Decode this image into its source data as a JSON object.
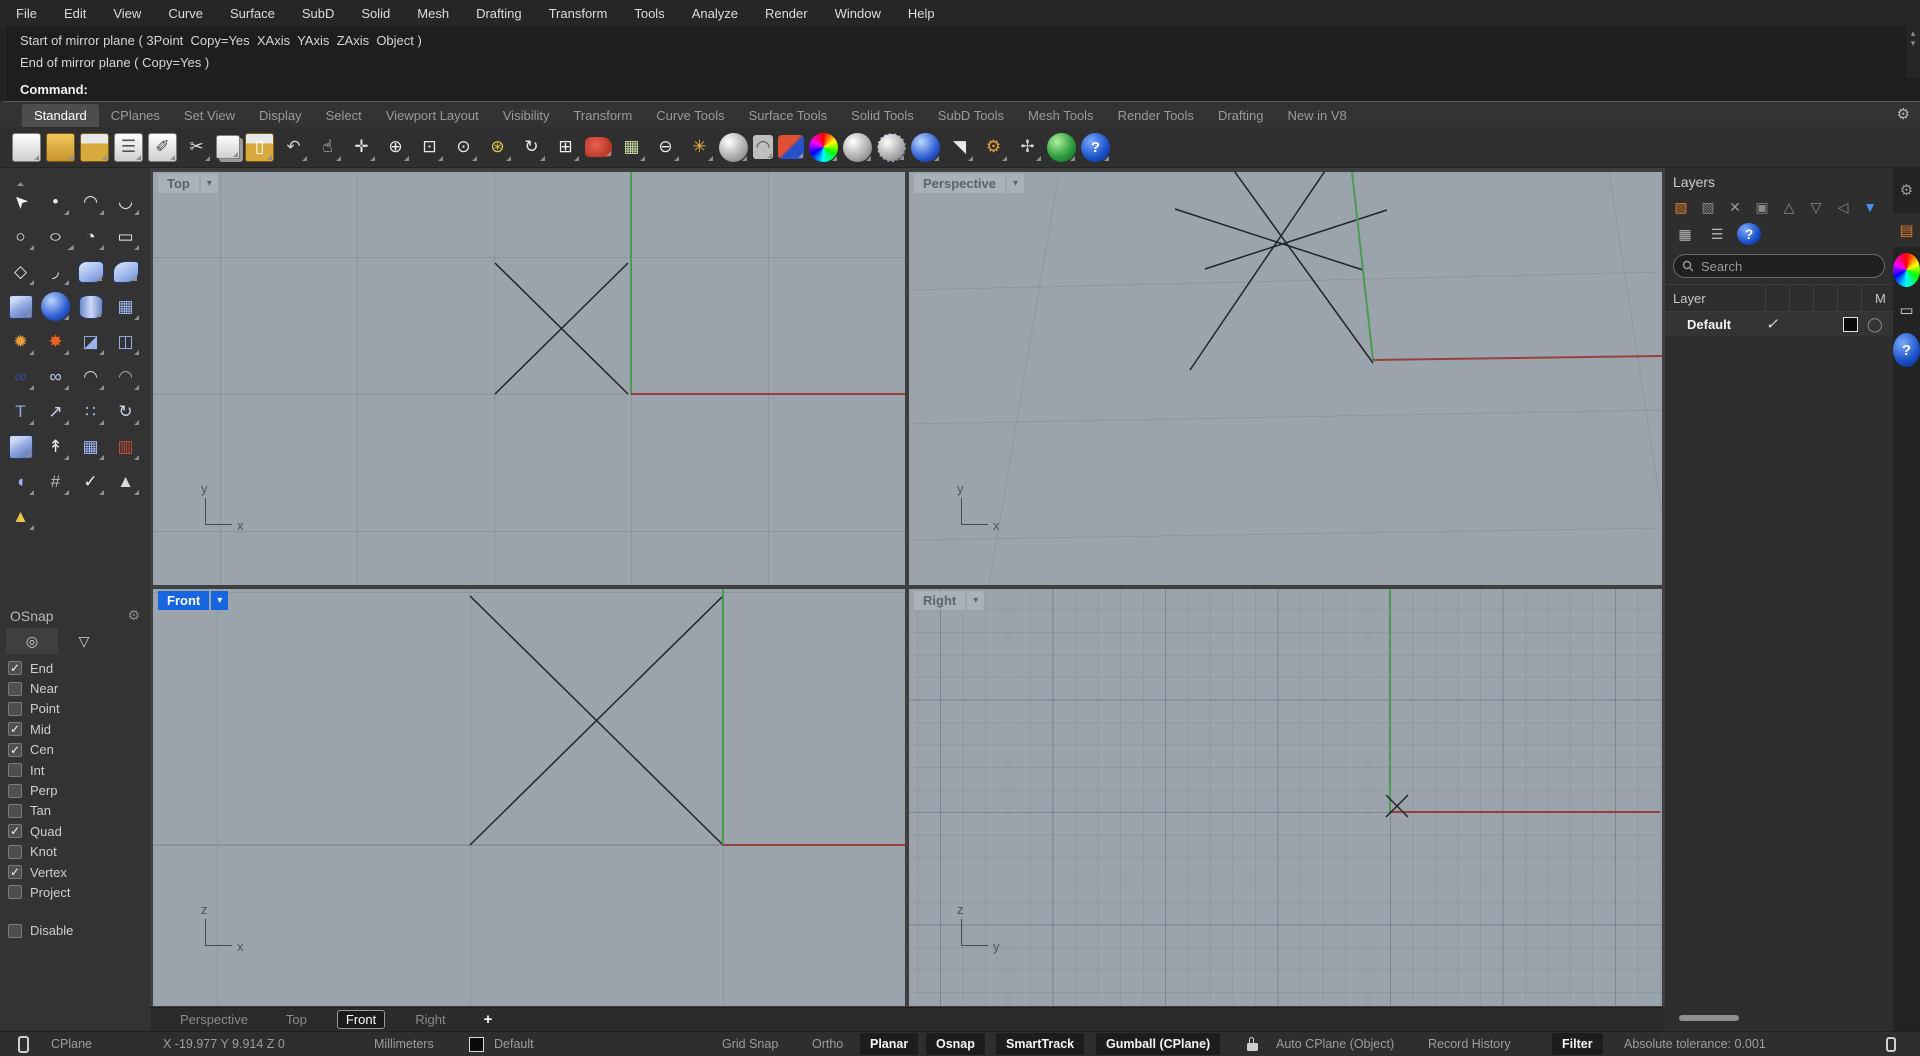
{
  "icons": {
    "gear": "⚙",
    "chevron_down": "▾",
    "scroll_up": "▴",
    "scroll_down": "▾",
    "plus": "+",
    "layer_check": "✓",
    "material_circle": "◯"
  },
  "menu": {
    "items": [
      "File",
      "Edit",
      "View",
      "Curve",
      "Surface",
      "SubD",
      "Solid",
      "Mesh",
      "Drafting",
      "Transform",
      "Tools",
      "Analyze",
      "Render",
      "Window",
      "Help"
    ]
  },
  "command": {
    "history": [
      "Start of mirror plane ( 3Point  Copy=Yes  XAxis  YAxis  ZAxis  Object )",
      "End of mirror plane ( Copy=Yes )"
    ],
    "prompt": "Command:"
  },
  "ribbon": {
    "tabs": [
      {
        "label": "Standard",
        "state": "active"
      },
      {
        "label": "CPlanes"
      },
      {
        "label": "Set View"
      },
      {
        "label": "Display"
      },
      {
        "label": "Select"
      },
      {
        "label": "Viewport Layout"
      },
      {
        "label": "Visibility"
      },
      {
        "label": "Transform"
      },
      {
        "label": "Curve Tools"
      },
      {
        "label": "Surface Tools"
      },
      {
        "label": "Solid Tools"
      },
      {
        "label": "SubD Tools"
      },
      {
        "label": "Mesh Tools"
      },
      {
        "label": "Render Tools"
      },
      {
        "label": "Drafting"
      },
      {
        "label": "New in V8"
      }
    ]
  },
  "toolbar": {
    "icons": [
      {
        "name": "new-file-icon",
        "glyph": "",
        "cls": "ic-page"
      },
      {
        "name": "open-file-icon",
        "glyph": "",
        "cls": "ic-folder"
      },
      {
        "name": "save-icon",
        "glyph": "",
        "cls": "ic-floppy"
      },
      {
        "name": "print-icon",
        "glyph": "☰",
        "cls": "ic-page",
        "fg": "#555555"
      },
      {
        "name": "edit-properties-icon",
        "glyph": "✐",
        "cls": "ic-page",
        "fg": "#444444"
      },
      {
        "name": "cut-icon",
        "glyph": "✂",
        "fg": "#dfe4ea"
      },
      {
        "name": "copy-icon",
        "glyph": "",
        "cls": "ic-page ic-copy"
      },
      {
        "name": "paste-icon",
        "glyph": "▯",
        "cls": "ic-floppy",
        "fg": "#ffffff"
      },
      {
        "name": "undo-icon",
        "glyph": "↶",
        "fg": "#cfcfcf"
      },
      {
        "name": "pan-icon",
        "glyph": "☝",
        "fg": "#f0f0f0"
      },
      {
        "name": "rotate-view-icon",
        "glyph": "✛",
        "fg": "#e8e8e8"
      },
      {
        "name": "zoom-icon",
        "glyph": "⊕",
        "fg": "#e8e8e8"
      },
      {
        "name": "zoom-window-icon",
        "glyph": "⊡",
        "fg": "#e8e8e8"
      },
      {
        "name": "zoom-selected-icon",
        "glyph": "⊙",
        "fg": "#e8e8e8"
      },
      {
        "name": "zoom-extents-icon",
        "glyph": "⊛",
        "fg": "#e8c84a"
      },
      {
        "name": "zoom-back-icon",
        "glyph": "↻",
        "fg": "#e8e8e8"
      },
      {
        "name": "viewport-layout-icon",
        "glyph": "⊞",
        "fg": "#f0f0f0"
      },
      {
        "name": "named-views-icon",
        "glyph": "",
        "cls": "ic-car"
      },
      {
        "name": "display-options-icon",
        "glyph": "▦",
        "fg": "#c8d8a0"
      },
      {
        "name": "cplane-icon",
        "glyph": "⊖",
        "fg": "#e8e8e8"
      },
      {
        "name": "osnap-settings-icon",
        "glyph": "✳",
        "fg": "#e8b13a"
      },
      {
        "name": "lamp-icon",
        "glyph": "",
        "cls": "ic-sph-w"
      },
      {
        "name": "lock-icon",
        "glyph": "◠",
        "cls": "ic-lockbody",
        "fg": "#555555"
      },
      {
        "name": "render-icon",
        "glyph": "",
        "cls": "ic-render"
      },
      {
        "name": "color-wheel-icon",
        "glyph": "",
        "cls": "ic-wheel"
      },
      {
        "name": "shaded-sphere-icon",
        "glyph": "",
        "cls": "ic-sph-w"
      },
      {
        "name": "rendered-sphere-icon",
        "glyph": "",
        "cls": "ic-sph-w ic-dots"
      },
      {
        "name": "raytrace-sphere-icon",
        "glyph": "",
        "cls": "ic-sph-b"
      },
      {
        "name": "spotlight-icon",
        "glyph": "◥",
        "fg": "#e8e8e8"
      },
      {
        "name": "options-gear-icon",
        "glyph": "⚙",
        "fg": "#e8a13a"
      },
      {
        "name": "gumball-widget-icon",
        "glyph": "✢",
        "fg": "#d0d0d0"
      },
      {
        "name": "earth-icon",
        "glyph": "",
        "cls": "ic-globe"
      },
      {
        "name": "help-icon",
        "glyph": "?",
        "cls": "ic-help"
      }
    ]
  },
  "sidebar": {
    "icons": [
      {
        "name": "select-arrow-icon",
        "glyph": "➤",
        "cls": "rot-up-left",
        "fg": "#f2f2f2"
      },
      {
        "name": "point-icon",
        "glyph": "•",
        "fg": "#e8e8e8"
      },
      {
        "name": "control-point-curve-icon",
        "glyph": "◠",
        "fg": "#e8e8e8"
      },
      {
        "name": "interpolate-curve-icon",
        "glyph": "◡",
        "fg": "#e8e8e8"
      },
      {
        "name": "circle-icon",
        "glyph": "○",
        "fg": "#e8e8e8"
      },
      {
        "name": "ellipse-icon",
        "glyph": "○",
        "cls": "wide",
        "fg": "#e8e8e8"
      },
      {
        "name": "arc-icon",
        "glyph": "◔",
        "fg": "#e8e8e8"
      },
      {
        "name": "rectangle-icon",
        "glyph": "▭",
        "fg": "#e8e8e8"
      },
      {
        "name": "polygon-icon",
        "glyph": "◇",
        "fg": "#e8e8e8"
      },
      {
        "name": "fillet-corner-icon",
        "glyph": "◞",
        "fg": "#e8e8e8"
      },
      {
        "name": "surface-from-points-icon",
        "glyph": "",
        "cls": "ic-patch"
      },
      {
        "name": "curved-surface-icon",
        "glyph": "",
        "cls": "ic-patch curved"
      },
      {
        "name": "box-icon",
        "glyph": "",
        "cls": "ic-cube"
      },
      {
        "name": "sphere-icon",
        "glyph": "",
        "cls": "ic-sph-b"
      },
      {
        "name": "cylinder-icon",
        "glyph": "",
        "cls": "ic-cyl"
      },
      {
        "name": "patch-grid-icon",
        "glyph": "▦",
        "fg": "#9ab4ec"
      },
      {
        "name": "explode-icon",
        "glyph": "✹",
        "fg": "#e8a13a"
      },
      {
        "name": "blast-icon",
        "glyph": "✸",
        "fg": "#e8641e"
      },
      {
        "name": "trim-icon",
        "glyph": "◪",
        "fg": "#9ab4ec"
      },
      {
        "name": "split-icon",
        "glyph": "◫",
        "fg": "#9ab4ec"
      },
      {
        "name": "boolean-union-icon",
        "glyph": "∞",
        "fg": "#3a4a9a"
      },
      {
        "name": "boolean-difference-icon",
        "glyph": "∞",
        "fg": "#bcd0f8"
      },
      {
        "name": "blend-curve-icon",
        "glyph": "◠",
        "fg": "#d8d8d8"
      },
      {
        "name": "adjustable-blend-icon",
        "glyph": "◠",
        "fg": "#a8a8a8"
      },
      {
        "name": "text-icon",
        "glyph": "T",
        "fg": "#8fa8e0"
      },
      {
        "name": "move-icon",
        "glyph": "↗",
        "fg": "#c8d4ec"
      },
      {
        "name": "copy-objects-icon",
        "glyph": "∷",
        "fg": "#9ab4ec"
      },
      {
        "name": "rotate-icon",
        "glyph": "↻",
        "fg": "#c8d4ec"
      },
      {
        "name": "solid-cube-icon",
        "glyph": "",
        "cls": "ic-cube"
      },
      {
        "name": "extrude-icon",
        "glyph": "↟",
        "fg": "#e8e8e8"
      },
      {
        "name": "array-icon",
        "glyph": "▦",
        "fg": "#9ab4ec"
      },
      {
        "name": "block-icon",
        "glyph": "▥",
        "fg": "#c84a3a"
      },
      {
        "name": "fillet-surface-icon",
        "glyph": "◖",
        "fg": "#9ab4ec"
      },
      {
        "name": "curve-network-icon",
        "glyph": "#",
        "fg": "#b8b8b8"
      },
      {
        "name": "check-icon",
        "glyph": "✓",
        "fg": "#f0f0f0"
      },
      {
        "name": "primitives-icon",
        "glyph": "▲",
        "fg": "#d8d8d8"
      },
      {
        "name": "pyramid-light-icon",
        "glyph": "▲",
        "fg": "#e8c84a"
      }
    ]
  },
  "osnap": {
    "title": "OSnap",
    "tabs": [
      {
        "name": "osnap-tab-icon",
        "glyph": "◎",
        "state": "active"
      },
      {
        "name": "filter-tab-icon",
        "glyph": "▽"
      }
    ],
    "items": [
      {
        "label": "End",
        "state": "checked"
      },
      {
        "label": "Near"
      },
      {
        "label": "Point"
      },
      {
        "label": "Mid",
        "state": "checked"
      },
      {
        "label": "Cen",
        "state": "checked"
      },
      {
        "label": "Int"
      },
      {
        "label": "Perp"
      },
      {
        "label": "Tan"
      },
      {
        "label": "Quad",
        "state": "checked"
      },
      {
        "label": "Knot"
      },
      {
        "label": "Vertex",
        "state": "checked"
      },
      {
        "label": "Project"
      }
    ],
    "disable_label": "Disable"
  },
  "viewports": {
    "top": {
      "label": "Top",
      "axis_v": "y",
      "axis_h": "x"
    },
    "perspective": {
      "label": "Perspective",
      "axis_v": "y",
      "axis_h": "x"
    },
    "front": {
      "label": "Front",
      "axis_v": "z",
      "axis_h": "x"
    },
    "right": {
      "label": "Right",
      "axis_v": "z",
      "axis_h": "y"
    }
  },
  "viewport_tabs": {
    "items": [
      {
        "label": "Perspective"
      },
      {
        "label": "Top"
      },
      {
        "label": "Front",
        "state": "active"
      },
      {
        "label": "Right"
      },
      {
        "label": "+",
        "state": "add"
      }
    ]
  },
  "layers": {
    "title": "Layers",
    "search_placeholder": "Search",
    "columns": {
      "name": "Layer",
      "material": "M"
    },
    "rows": [
      {
        "name": "Default"
      }
    ],
    "tools": [
      {
        "name": "new-layer-icon",
        "glyph": "▧",
        "fg": "#e07b2a"
      },
      {
        "name": "new-sublayer-icon",
        "glyph": "▧",
        "fg": "#8a8a8a"
      },
      {
        "name": "delete-layer-icon",
        "glyph": "✕",
        "fg": "#9a9a9a"
      },
      {
        "name": "duplicate-layer-icon",
        "glyph": "▣",
        "fg": "#8a8a8a"
      },
      {
        "name": "move-up-icon",
        "glyph": "△",
        "fg": "#8a8a8a"
      },
      {
        "name": "move-down-icon",
        "glyph": "▽",
        "fg": "#8a8a8a"
      },
      {
        "name": "move-left-icon",
        "glyph": "◁",
        "fg": "#8a8a8a"
      },
      {
        "name": "filter-layers-icon",
        "glyph": "▼",
        "fg": "#4a90e2"
      }
    ],
    "tools2": [
      {
        "name": "grid-view-icon",
        "glyph": "▦",
        "fg": "#b5b5b5"
      },
      {
        "name": "list-view-icon",
        "glyph": "☰",
        "fg": "#b5b5b5"
      },
      {
        "name": "layers-help-icon",
        "glyph": "?",
        "cls": "ic-help mini"
      }
    ],
    "side_tabs": [
      {
        "name": "panel-gear-icon",
        "glyph": "⚙",
        "fg": "#9a9a9a"
      },
      {
        "name": "layers-tab-icon",
        "glyph": "▤",
        "fg": "#e07b2a",
        "cls": "active-tab"
      },
      {
        "name": "color-wheel-tab-icon",
        "glyph": "",
        "cls": "ic-wheel mini"
      },
      {
        "name": "display-tab-icon",
        "glyph": "▭",
        "fg": "#d8d8d8"
      },
      {
        "name": "help-tab-icon",
        "glyph": "?",
        "cls": "ic-help mini"
      }
    ]
  },
  "status_bar": {
    "cplane": "CPlane",
    "coordinates": "X -19.977 Y 9.914 Z 0",
    "units": "Millimeters",
    "current_layer": "Default",
    "grid_snap": "Grid Snap",
    "ortho": "Ortho",
    "planar": "Planar",
    "osnap": "Osnap",
    "smarttrack": "SmartTrack",
    "gumball": "Gumball (CPlane)",
    "auto_cplane": "Auto CPlane (Object)",
    "record_history": "Record History",
    "filter": "Filter",
    "tolerance": "Absolute tolerance: 0.001"
  }
}
